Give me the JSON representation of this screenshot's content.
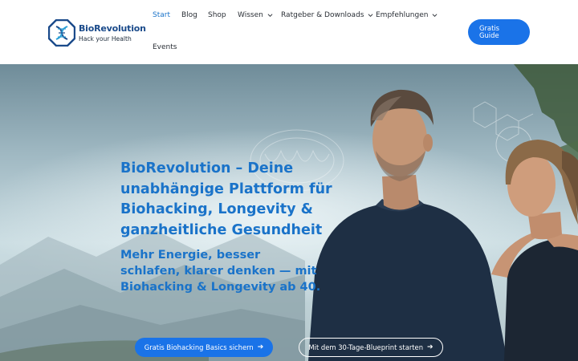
{
  "header": {
    "logo": {
      "name": "BioRevolution",
      "tagline": "Hack your Health"
    },
    "nav": [
      {
        "label": "Start",
        "active": true,
        "dropdown": false
      },
      {
        "label": "Blog",
        "active": false,
        "dropdown": false
      },
      {
        "label": "Shop",
        "active": false,
        "dropdown": false
      },
      {
        "label": "Wissen",
        "active": false,
        "dropdown": true
      },
      {
        "label": "Ratgeber & Downloads",
        "active": false,
        "dropdown": true
      },
      {
        "label": "Empfehlungen",
        "active": false,
        "dropdown": true
      },
      {
        "label": "Events",
        "active": false,
        "dropdown": false
      }
    ],
    "cta": {
      "line1": "Gratis",
      "line2": "Guide"
    }
  },
  "hero": {
    "title": "BioRevolution – Deine unabhängige Plattform für Biohacking, Longevity & ganzheitliche Gesundheit",
    "subtitle": "Mehr Energie, besser schlafen, klarer denken — mit Biohacking & Longevity ab 40.",
    "primary_button": "Gratis Biohacking Basics sichern",
    "secondary_button": "Mit dem 30-Tage-Blueprint starten",
    "arrow_icon": "arrow-right-icon"
  },
  "colors": {
    "accent": "#1a73e8",
    "heading": "#1a73c9",
    "nav_text": "#2a2f36",
    "logo_blue": "#1a4a8a"
  }
}
